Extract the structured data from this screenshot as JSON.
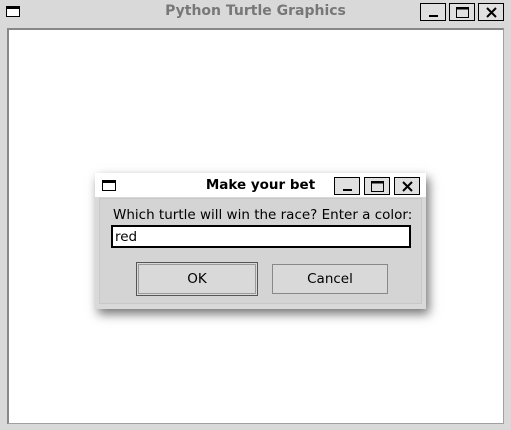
{
  "main_window": {
    "title": "Python Turtle Graphics",
    "icon": "window-icon",
    "controls": [
      "minimize-icon",
      "maximize-icon",
      "close-icon"
    ]
  },
  "dialog": {
    "title": "Make your bet",
    "icon": "window-icon",
    "controls": [
      "minimize-icon",
      "maximize-icon",
      "close-icon"
    ],
    "prompt": "Which turtle will win the race? Enter a color:",
    "input_value": "red",
    "ok_label": "OK",
    "cancel_label": "Cancel"
  }
}
